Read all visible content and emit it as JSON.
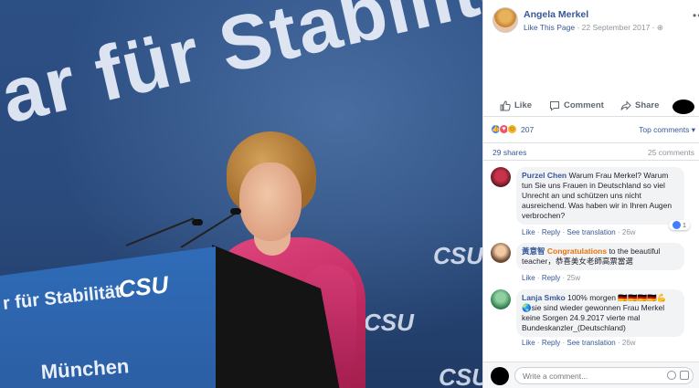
{
  "photo": {
    "banner_text": "ar für Stabilität",
    "podium_text": "r für Stabilität",
    "podium_logo": "CSU",
    "podium_city": "München",
    "backdrop_logo": "CSU"
  },
  "post": {
    "author": "Angela Merkel",
    "like_page": "Like This Page",
    "date": "22 September 2017",
    "more": "•••"
  },
  "actions": {
    "like": "Like",
    "comment": "Comment",
    "share": "Share"
  },
  "reactions": {
    "count": "207",
    "sort": "Top comments ▾",
    "shares": "29 shares",
    "comments": "25 comments"
  },
  "comments": [
    {
      "name": "Purzel Chen",
      "text": "Warum Frau Merkel? Warum tun Sie uns Frauen in Deutschland so viel Unrecht an und schützen uns nicht ausreichend. Was haben wir in Ihren Augen verbrochen?",
      "like": "Like",
      "reply": "Reply",
      "translate": "See translation",
      "age": "26w",
      "react_count": "1"
    },
    {
      "name": "黃意智",
      "highlight": "Congratulations",
      "text": "to the beautiful teacher，恭喜美女老師高票當選",
      "like": "Like",
      "reply": "Reply",
      "age": "25w"
    },
    {
      "name": "Lanja Smko",
      "text_1": "100% morgen 🇩🇪🇩🇪🇩🇪🇩🇪💪",
      "text_2": "🌏sie sind wieder gewonnen Frau Merkel keine Sorgen 24.9.2017 vierte mal Bundeskanzler_(Deutschland)",
      "like": "Like",
      "reply": "Reply",
      "translate": "See translation",
      "age": "26w"
    }
  ],
  "composer": {
    "placeholder": "Write a comment..."
  },
  "colors": {
    "link": "#365899",
    "jacket": "#c0295f",
    "backdrop": "#2c4f84"
  }
}
